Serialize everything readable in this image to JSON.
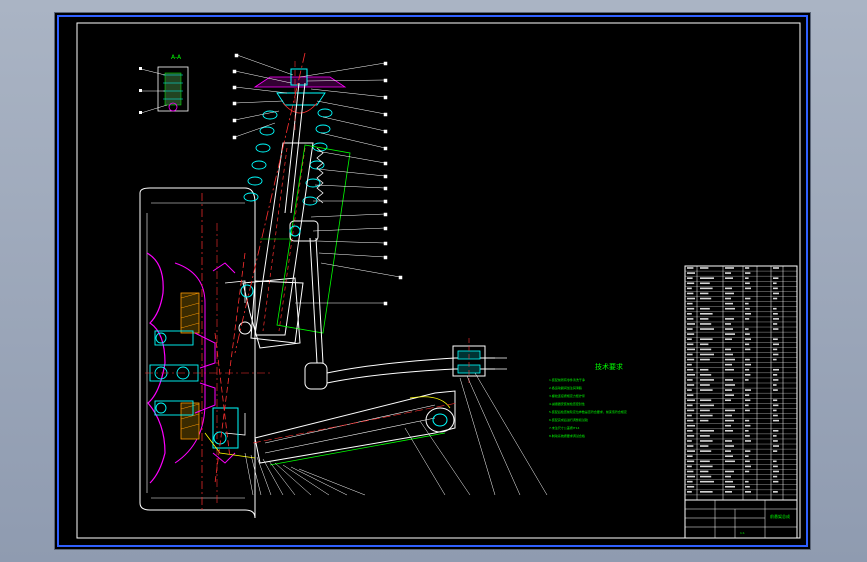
{
  "drawing": {
    "detail_label": "A-A",
    "tech_req_title": "技术要求",
    "tech_requirements": [
      "1.装配前所有零件清洗干净",
      "2.各运动副间加注润滑脂",
      "3.螺纹连接按规定力矩拧紧",
      "4.减振器安装前检查密封性",
      "5.装配后检查前轮定位参数是否符合要求，前束值符合规定",
      "6.装配完成后进行调整和试验",
      "7.未注尺寸公差按IT14",
      "8.制动系统按要求调试合格"
    ],
    "title_block": {
      "drawing_title": "前悬架总成",
      "scale": "1:1"
    },
    "colors": {
      "frame": "#ffffff",
      "outline": "#ffffff",
      "cyan": "#00ffff",
      "magenta": "#ff00ff",
      "red": "#ff3030",
      "green": "#00ff00",
      "sheet_bg": "#000000",
      "desktop": "#9aa5b8"
    }
  }
}
